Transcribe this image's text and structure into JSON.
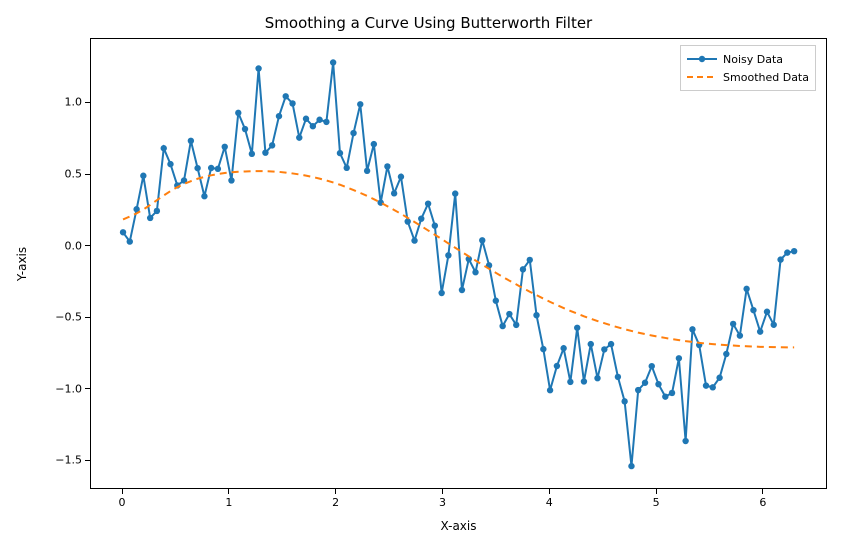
{
  "chart_data": {
    "type": "line",
    "title": "Smoothing a Curve Using Butterworth Filter",
    "xlabel": "X-axis",
    "ylabel": "Y-axis",
    "xticks": [
      0,
      1,
      2,
      3,
      4,
      5,
      6
    ],
    "yticks": [
      -1.5,
      -1.0,
      -0.5,
      0.0,
      0.5,
      1.0
    ],
    "xlim": [
      -0.3,
      6.6
    ],
    "ylim": [
      -1.7,
      1.45
    ],
    "legend_position": "upper-right",
    "series": [
      {
        "name": "Noisy Data",
        "style": "line+marker",
        "color": "#1f77b4",
        "x": [
          0.0,
          0.063,
          0.127,
          0.19,
          0.254,
          0.317,
          0.381,
          0.444,
          0.508,
          0.571,
          0.635,
          0.698,
          0.762,
          0.825,
          0.888,
          0.952,
          1.015,
          1.079,
          1.142,
          1.206,
          1.269,
          1.333,
          1.396,
          1.46,
          1.523,
          1.587,
          1.65,
          1.713,
          1.777,
          1.84,
          1.904,
          1.967,
          2.031,
          2.094,
          2.158,
          2.221,
          2.285,
          2.348,
          2.412,
          2.475,
          2.538,
          2.602,
          2.665,
          2.729,
          2.792,
          2.856,
          2.919,
          2.983,
          3.046,
          3.11,
          3.173,
          3.237,
          3.3,
          3.363,
          3.427,
          3.49,
          3.554,
          3.617,
          3.681,
          3.744,
          3.808,
          3.871,
          3.935,
          3.998,
          4.062,
          4.125,
          4.188,
          4.252,
          4.315,
          4.379,
          4.442,
          4.506,
          4.569,
          4.633,
          4.696,
          4.76,
          4.823,
          4.887,
          4.95,
          5.013,
          5.077,
          5.14,
          5.204,
          5.267,
          5.331,
          5.394,
          5.458,
          5.521,
          5.585,
          5.648,
          5.712,
          5.775,
          5.838,
          5.902,
          5.965,
          6.029,
          6.092,
          6.156,
          6.219,
          6.283
        ],
        "values": [
          0.1,
          0.035,
          0.261,
          0.495,
          0.2,
          0.249,
          0.687,
          0.576,
          0.427,
          0.462,
          0.739,
          0.548,
          0.352,
          0.549,
          0.543,
          0.697,
          0.462,
          0.934,
          0.821,
          0.648,
          1.244,
          0.656,
          0.707,
          0.911,
          1.05,
          1.0,
          0.761,
          0.893,
          0.841,
          0.886,
          0.871,
          1.286,
          0.653,
          0.55,
          0.793,
          0.994,
          0.529,
          0.716,
          0.307,
          0.56,
          0.372,
          0.488,
          0.175,
          0.042,
          0.195,
          0.3,
          0.146,
          -0.324,
          -0.061,
          0.37,
          -0.303,
          -0.087,
          -0.179,
          0.044,
          -0.131,
          -0.378,
          -0.555,
          -0.471,
          -0.547,
          -0.159,
          -0.093,
          -0.479,
          -0.716,
          -1.003,
          -0.834,
          -0.71,
          -0.945,
          -0.567,
          -0.942,
          -0.681,
          -0.919,
          -0.718,
          -0.681,
          -0.91,
          -1.081,
          -1.533,
          -1.002,
          -0.951,
          -0.835,
          -0.961,
          -1.048,
          -1.022,
          -0.78,
          -1.358,
          -0.578,
          -0.687,
          -0.971,
          -0.983,
          -0.916,
          -0.75,
          -0.54,
          -0.622,
          -0.295,
          -0.444,
          -0.594,
          -0.455,
          -0.546,
          -0.091,
          -0.042,
          -0.032
        ]
      },
      {
        "name": "Smoothed Data",
        "style": "dashed",
        "color": "#ff7f0e",
        "x": [
          0.0,
          0.063,
          0.127,
          0.19,
          0.254,
          0.317,
          0.381,
          0.444,
          0.508,
          0.571,
          0.635,
          0.698,
          0.762,
          0.825,
          0.888,
          0.952,
          1.015,
          1.079,
          1.142,
          1.206,
          1.269,
          1.333,
          1.396,
          1.46,
          1.523,
          1.587,
          1.65,
          1.713,
          1.777,
          1.84,
          1.904,
          1.967,
          2.031,
          2.094,
          2.158,
          2.221,
          2.285,
          2.348,
          2.412,
          2.475,
          2.538,
          2.602,
          2.665,
          2.729,
          2.792,
          2.856,
          2.919,
          2.983,
          3.046,
          3.11,
          3.173,
          3.237,
          3.3,
          3.363,
          3.427,
          3.49,
          3.554,
          3.617,
          3.681,
          3.744,
          3.808,
          3.871,
          3.935,
          3.998,
          4.062,
          4.125,
          4.188,
          4.252,
          4.315,
          4.379,
          4.442,
          4.506,
          4.569,
          4.633,
          4.696,
          4.76,
          4.823,
          4.887,
          4.95,
          5.013,
          5.077,
          5.14,
          5.204,
          5.267,
          5.331,
          5.394,
          5.458,
          5.521,
          5.585,
          5.648,
          5.712,
          5.775,
          5.838,
          5.902,
          5.965,
          6.029,
          6.092,
          6.156,
          6.219,
          6.283
        ],
        "values": [
          0.19,
          0.21,
          0.232,
          0.259,
          0.291,
          0.324,
          0.357,
          0.388,
          0.415,
          0.438,
          0.457,
          0.474,
          0.487,
          0.498,
          0.507,
          0.514,
          0.519,
          0.523,
          0.525,
          0.527,
          0.527,
          0.527,
          0.525,
          0.522,
          0.517,
          0.511,
          0.504,
          0.496,
          0.486,
          0.475,
          0.462,
          0.448,
          0.432,
          0.414,
          0.395,
          0.375,
          0.354,
          0.331,
          0.307,
          0.282,
          0.256,
          0.229,
          0.201,
          0.172,
          0.143,
          0.113,
          0.083,
          0.053,
          0.022,
          -0.008,
          -0.038,
          -0.068,
          -0.097,
          -0.126,
          -0.155,
          -0.183,
          -0.211,
          -0.238,
          -0.264,
          -0.29,
          -0.315,
          -0.339,
          -0.363,
          -0.386,
          -0.408,
          -0.429,
          -0.449,
          -0.468,
          -0.487,
          -0.504,
          -0.52,
          -0.535,
          -0.55,
          -0.564,
          -0.577,
          -0.589,
          -0.601,
          -0.611,
          -0.621,
          -0.63,
          -0.638,
          -0.646,
          -0.653,
          -0.66,
          -0.666,
          -0.672,
          -0.677,
          -0.681,
          -0.685,
          -0.688,
          -0.691,
          -0.694,
          -0.696,
          -0.698,
          -0.7,
          -0.701,
          -0.702,
          -0.703,
          -0.704,
          -0.704
        ]
      }
    ]
  }
}
